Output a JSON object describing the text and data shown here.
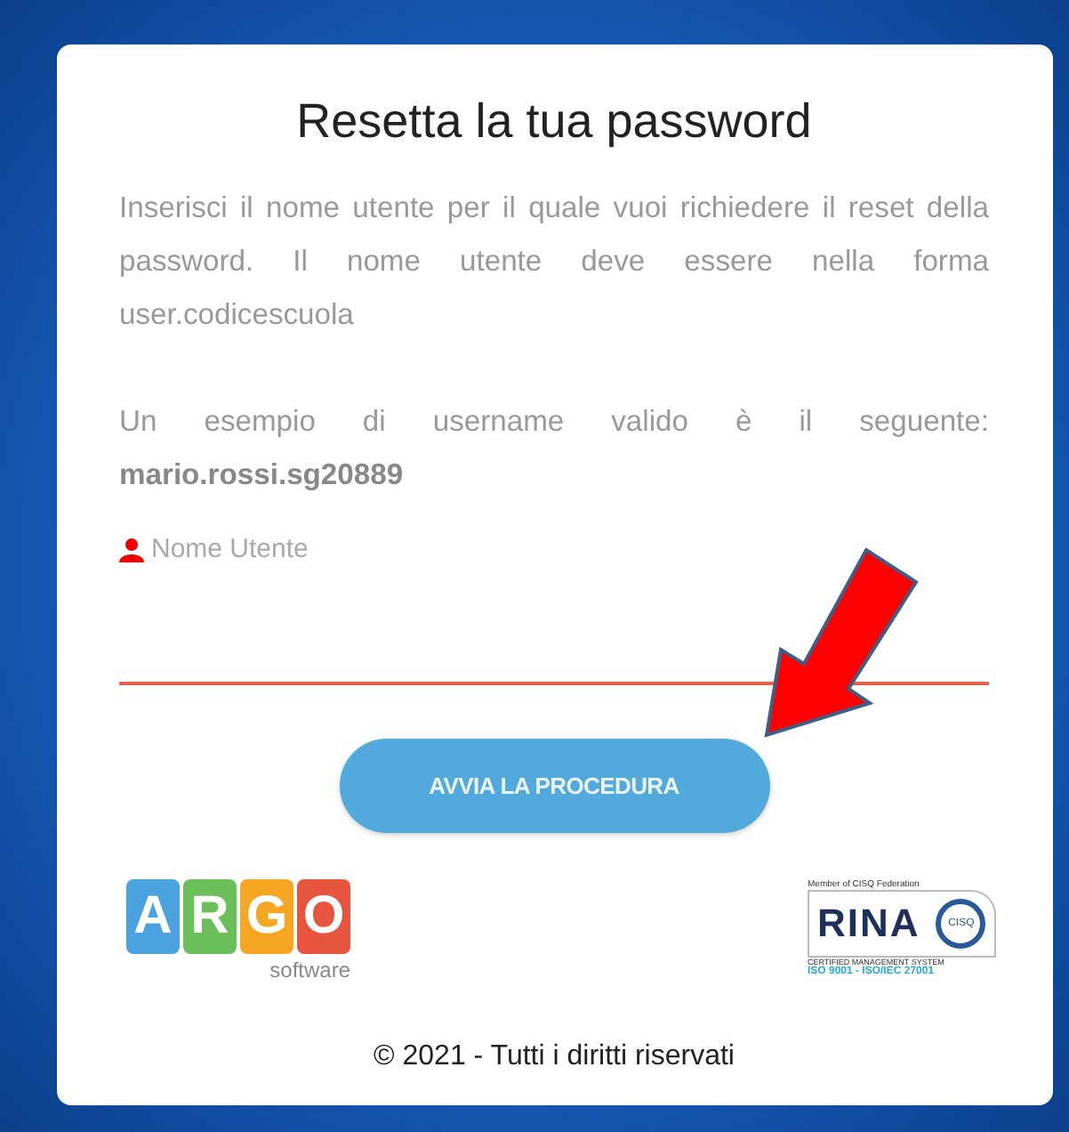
{
  "title": "Resetta la tua password",
  "paragraphs": [
    "Inserisci il nome utente per il quale vuoi richiedere il reset della password. Il nome utente deve essere nella forma user.codicescuola",
    "Un esempio di username valido è il seguente: **mario.rossi.sg20889**"
  ],
  "username_field": {
    "label": "Nome Utente"
  },
  "submit_button": "AVVIA LA PROCEDURA",
  "argo_logo": {
    "letters": [
      {
        "text": "A",
        "color": "#4aa3df"
      },
      {
        "text": "R",
        "color": "#6abf5a"
      },
      {
        "text": "G",
        "color": "#f5a623"
      },
      {
        "text": "O",
        "color": "#e8553f"
      }
    ],
    "subtitle": "software"
  },
  "rina_logo": {
    "top": "Member of CISQ Federation",
    "brand": "RINA",
    "seal": "CISQ",
    "caption": "CERTIFIED MANAGEMENT SYSTEM",
    "standards": "ISO 9001 - ISO/IEC 27001"
  },
  "footer": "© 2021 - Tutti i diritti riservati"
}
